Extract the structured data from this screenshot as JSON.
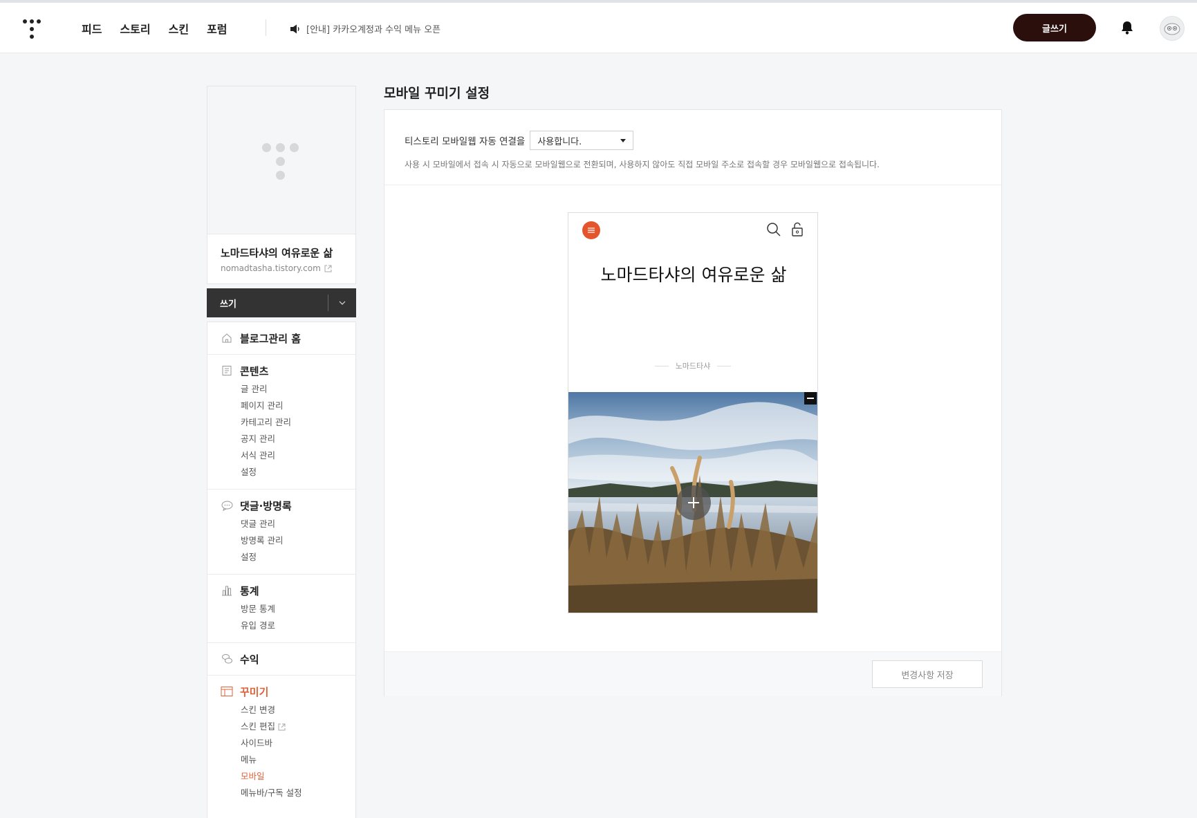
{
  "header": {
    "nav": [
      "피드",
      "스토리",
      "스킨",
      "포럼"
    ],
    "notice": "[안내] 카카오계정과 수익 메뉴 오픈",
    "write_label": "글쓰기"
  },
  "profile": {
    "blog_name": "노마드타샤의 여유로운 삶",
    "blog_url": "nomadtasha.tistory.com"
  },
  "write_bar": {
    "label": "쓰기"
  },
  "menu": {
    "groups": [
      {
        "title": "블로그관리 홈",
        "icon": "home-icon",
        "items": []
      },
      {
        "title": "콘텐츠",
        "icon": "document-icon",
        "items": [
          "글 관리",
          "페이지 관리",
          "카테고리 관리",
          "공지 관리",
          "서식 관리",
          "설정"
        ]
      },
      {
        "title": "댓글·방명록",
        "icon": "comment-icon",
        "items": [
          "댓글 관리",
          "방명록 관리",
          "설정"
        ]
      },
      {
        "title": "통계",
        "icon": "chart-icon",
        "items": [
          "방문 통계",
          "유입 경로"
        ]
      },
      {
        "title": "수익",
        "icon": "coin-icon",
        "items": []
      },
      {
        "title": "꾸미기",
        "icon": "layout-icon",
        "items": [
          "스킨 변경",
          "스킨 편집",
          "사이드바",
          "메뉴",
          "모바일",
          "메뉴바/구독 설정"
        ]
      }
    ],
    "active_group": "꾸미기",
    "active_item": "모바일"
  },
  "main": {
    "title": "모바일 꾸미기 설정",
    "setting_label": "티스토리 모바일웹 자동 연결을",
    "select_value": "사용합니다.",
    "description": "사용 시 모바일에서 접속 시 자동으로 모바일웹으로 전환되며, 사용하지 않아도 직접 모바일 주소로 접속할 경우 모바일웹으로 접속됩니다.",
    "save_label": "변경사항 저장"
  },
  "preview": {
    "title": "노마드타샤의 여유로운 삶",
    "author": "노마드타샤"
  },
  "colors": {
    "accent": "#e0623a",
    "write_button": "#2a0f0c",
    "dark_bar": "#333333"
  }
}
